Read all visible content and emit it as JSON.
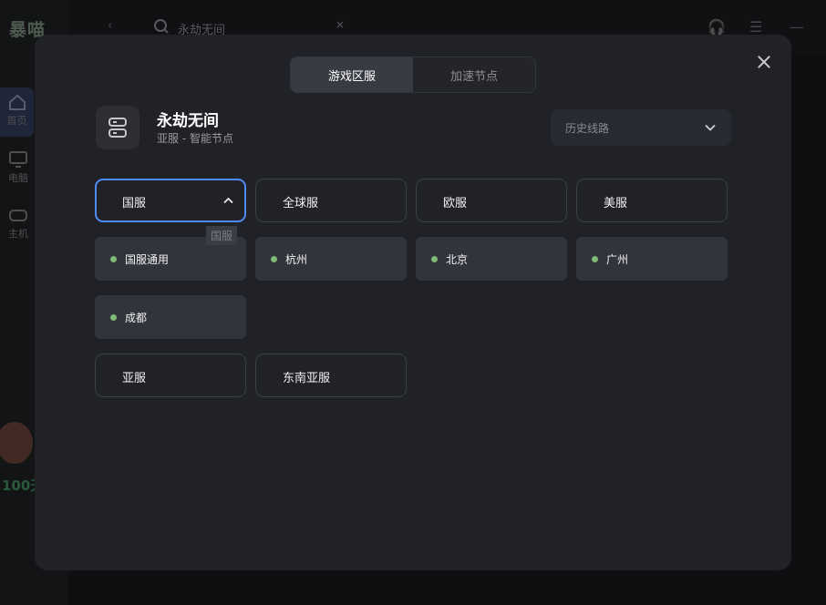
{
  "background": {
    "logo": "暴喵",
    "nav": [
      {
        "label": "首页",
        "icon": "home-icon"
      },
      {
        "label": "电脑",
        "icon": "monitor-icon"
      },
      {
        "label": "主机",
        "icon": "gamepad-icon"
      }
    ],
    "days": "100天",
    "search_text": "永劫无间",
    "colors": {
      "accent_green": "#3a7a52",
      "nav_active": "#2c3551"
    }
  },
  "modal": {
    "tabs": [
      {
        "label": "游戏区服",
        "active": true
      },
      {
        "label": "加速节点",
        "active": false
      }
    ],
    "game": {
      "title": "永劫无间",
      "subtitle": "亚服 - 智能节点",
      "icon": "server-icon"
    },
    "history_label": "历史线路",
    "regions_row1": [
      "国服",
      "全球服",
      "欧服",
      "美服"
    ],
    "selected_region": "国服",
    "tooltip": "国服",
    "nodes": [
      "国服通用",
      "杭州",
      "北京",
      "广州",
      "成都"
    ],
    "regions_row2": [
      "亚服",
      "东南亚服"
    ],
    "colors": {
      "selected_border": "#4d8cf5",
      "node_dot": "#7fbd75",
      "modal_bg": "#202228"
    }
  }
}
